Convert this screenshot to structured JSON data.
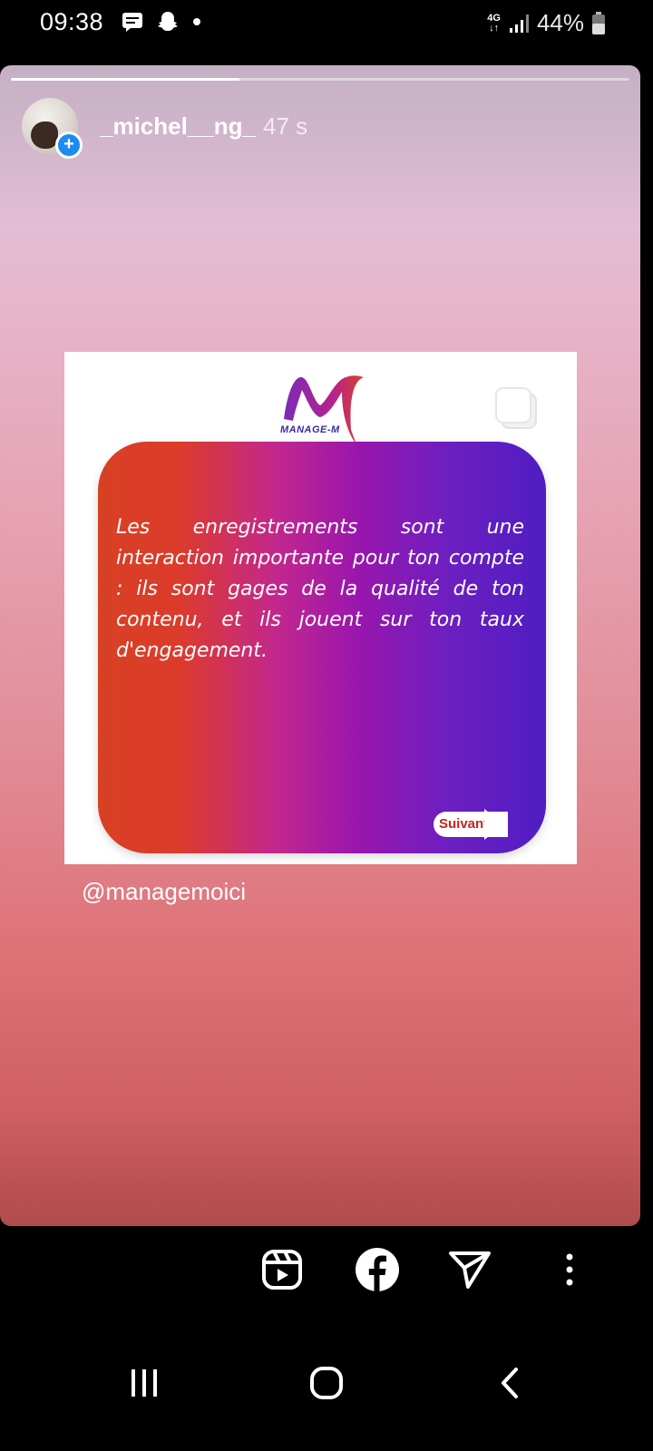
{
  "status_bar": {
    "time": "09:38",
    "network": "4G",
    "battery": "44%",
    "icons": [
      "message-icon",
      "snapchat-icon",
      "dot-icon",
      "signal-icon",
      "battery-icon"
    ]
  },
  "story": {
    "username": "_michel__ng_",
    "time_ago": "47 s",
    "progress": 0.37,
    "post": {
      "brand": "MANAGE-M",
      "card_text": "Les enregistrements sont une interaction importante pour ton compte : ils sont gages de la qualité de ton contenu, et ils jouent sur ton taux d'engagement.",
      "next_label": "Suivant"
    },
    "mention": "@managemoici"
  },
  "actions": [
    "reels-icon",
    "facebook-icon",
    "send-icon",
    "more-icon"
  ],
  "nav": [
    "recents-icon",
    "home-icon",
    "back-icon"
  ],
  "colors": {
    "card_left": "#d84124",
    "card_right": "#4f1dc3",
    "accent_blue": "#1d8cf2"
  }
}
